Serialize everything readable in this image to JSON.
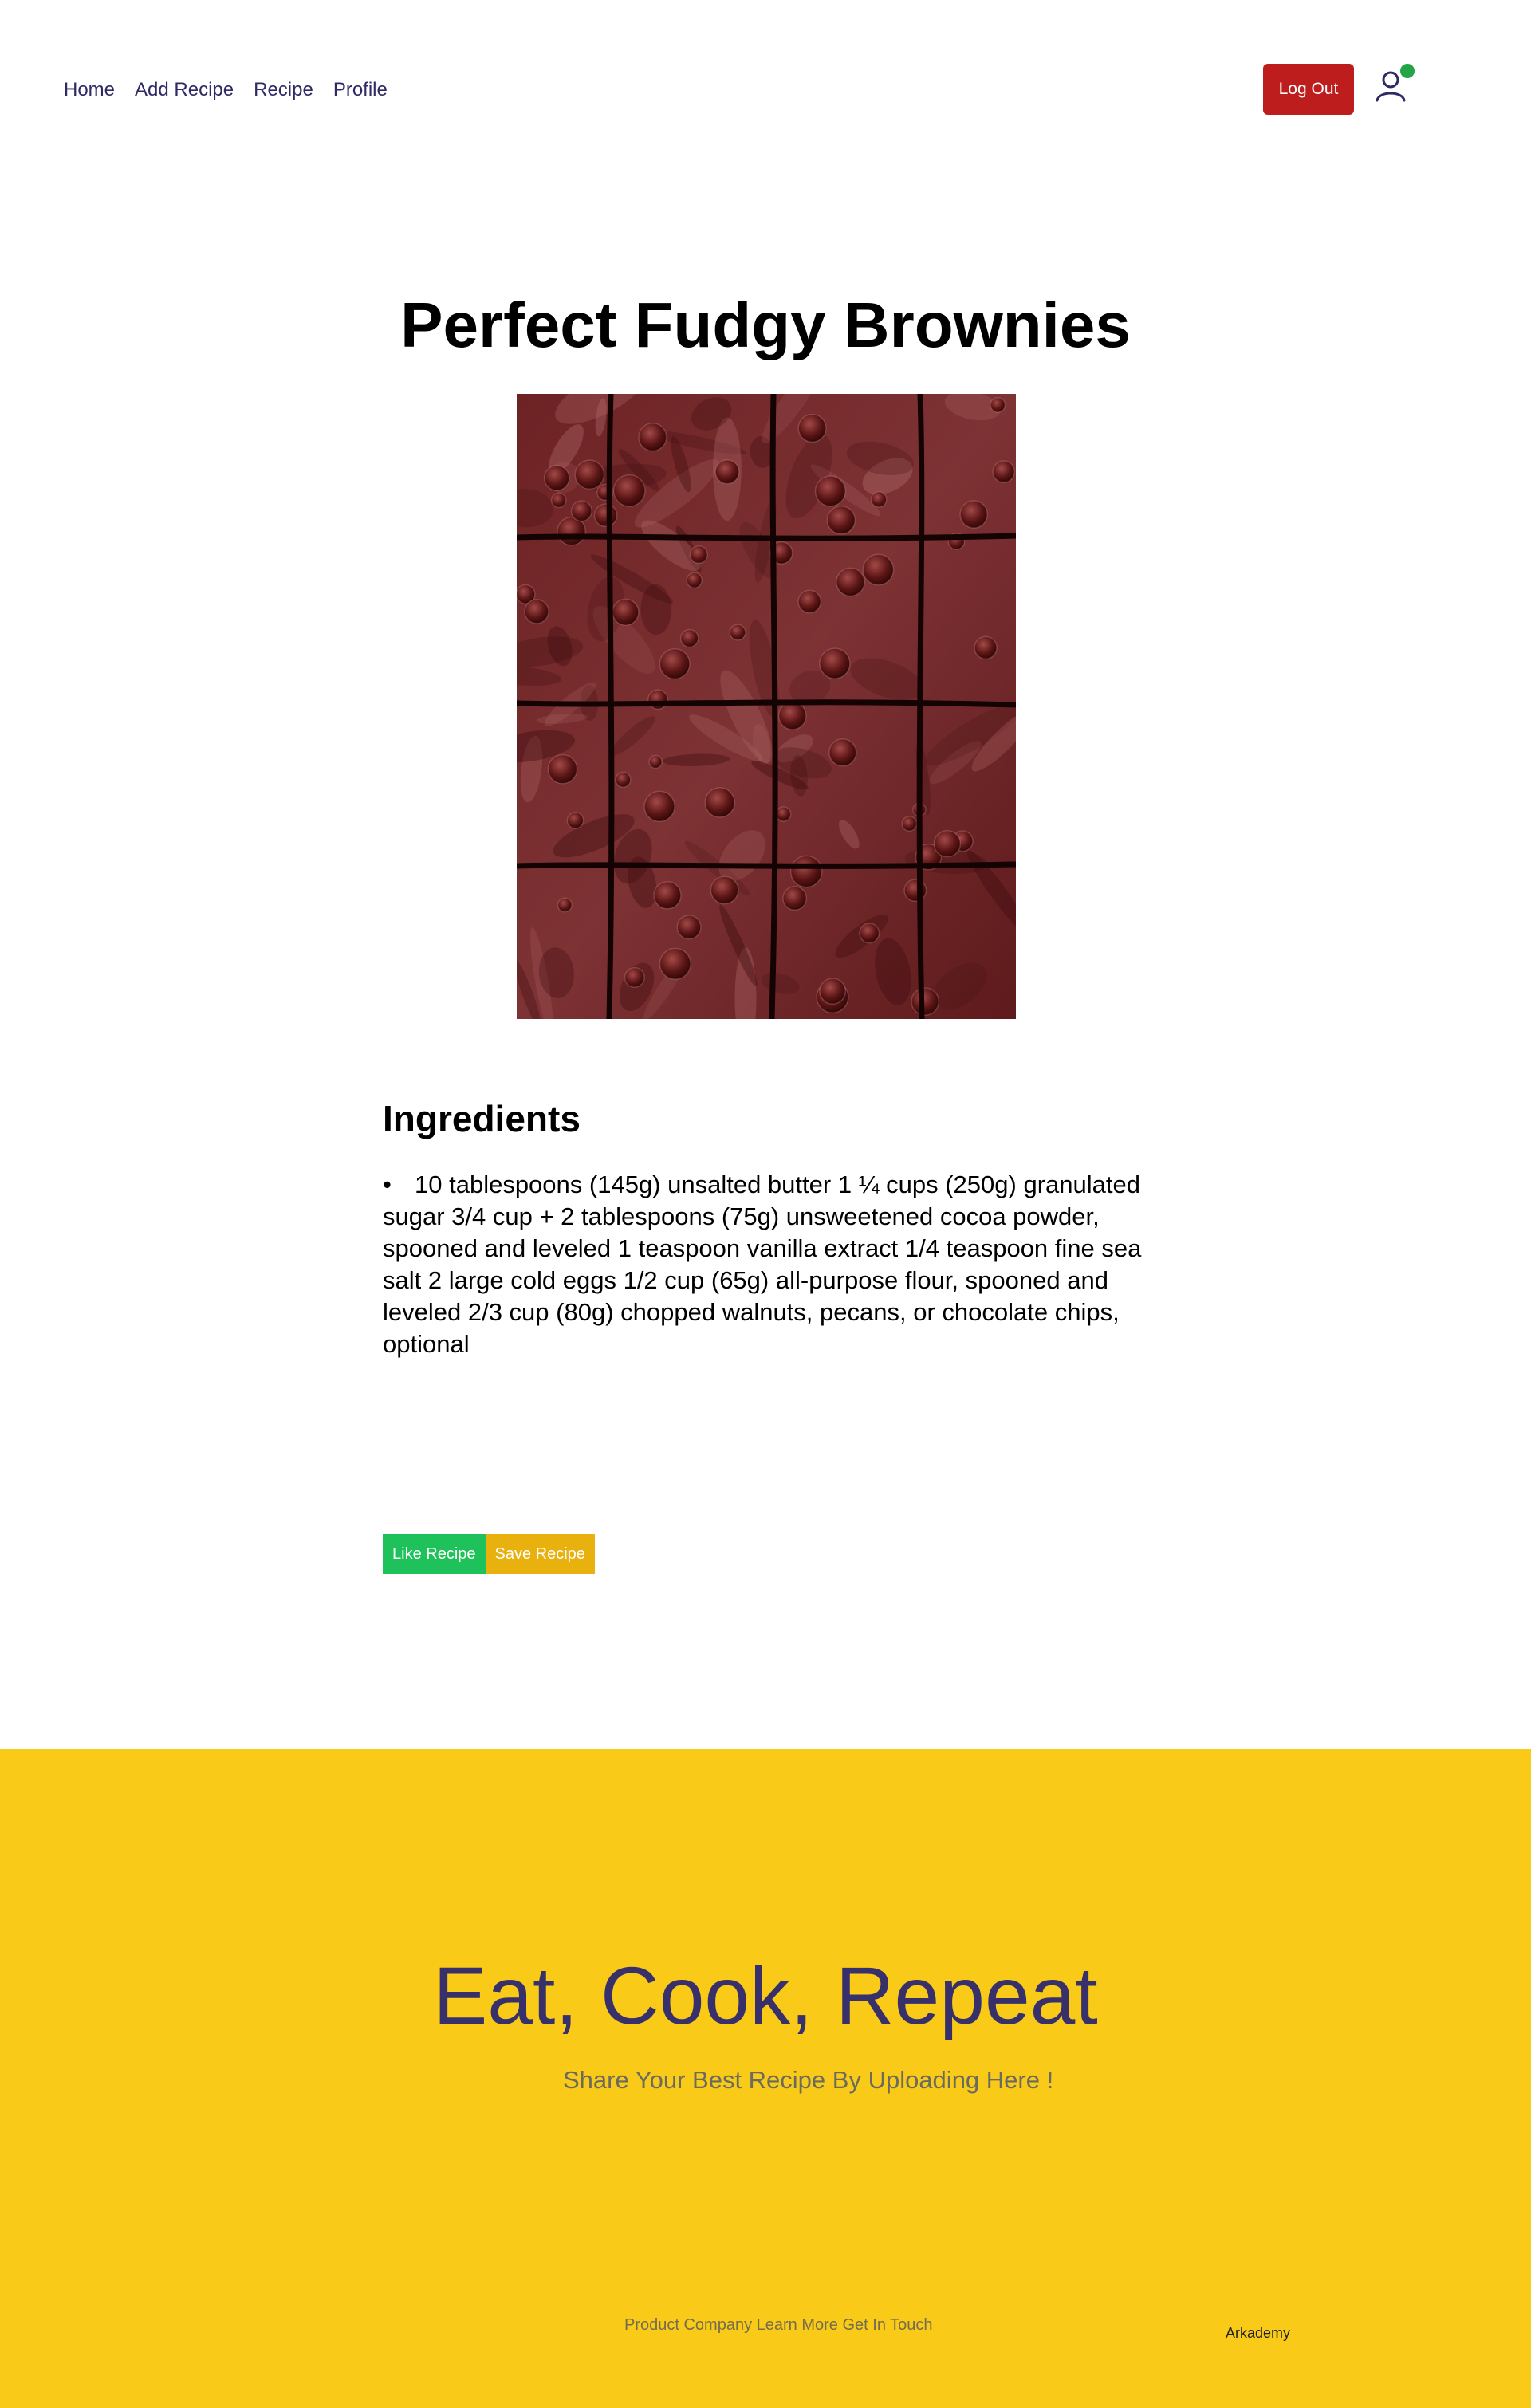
{
  "nav": {
    "items": [
      {
        "label": "Home"
      },
      {
        "label": "Add Recipe"
      },
      {
        "label": "Recipe"
      },
      {
        "label": "Profile"
      }
    ],
    "logout_label": "Log Out",
    "avatar_icon": "user-icon",
    "online_status_color": "#22a447"
  },
  "recipe": {
    "title": "Perfect Fudgy Brownies",
    "image_alt": "Brownies",
    "ingredients_heading": "Ingredients",
    "ingredients": [
      "10 tablespoons (145g) unsalted butter 1 ¼ cups (250g) granulated sugar 3/4 cup + 2 tablespoons (75g) unsweetened cocoa powder, spooned and leveled 1 teaspoon vanilla extract 1/4 teaspoon fine sea salt 2 large cold eggs 1/2 cup (65g) all-purpose flour, spooned and leveled 2/3 cup (80g) chopped walnuts, pecans, or chocolate chips, optional"
    ],
    "like_label": "Like Recipe",
    "save_label": "Save Recipe"
  },
  "footer": {
    "slogan": "Eat, Cook, Repeat",
    "tagline": "Share Your Best Recipe By Uploading Here !",
    "links_text": "Product Company Learn More Get In Touch",
    "brand": "Arkademy",
    "background_color": "#f9cb18"
  },
  "colors": {
    "nav_link": "#2e2a66",
    "logout_bg": "#bd1d1d",
    "like_bg": "#1ec15a",
    "save_bg": "#e8b10e",
    "slogan": "#37306b"
  }
}
